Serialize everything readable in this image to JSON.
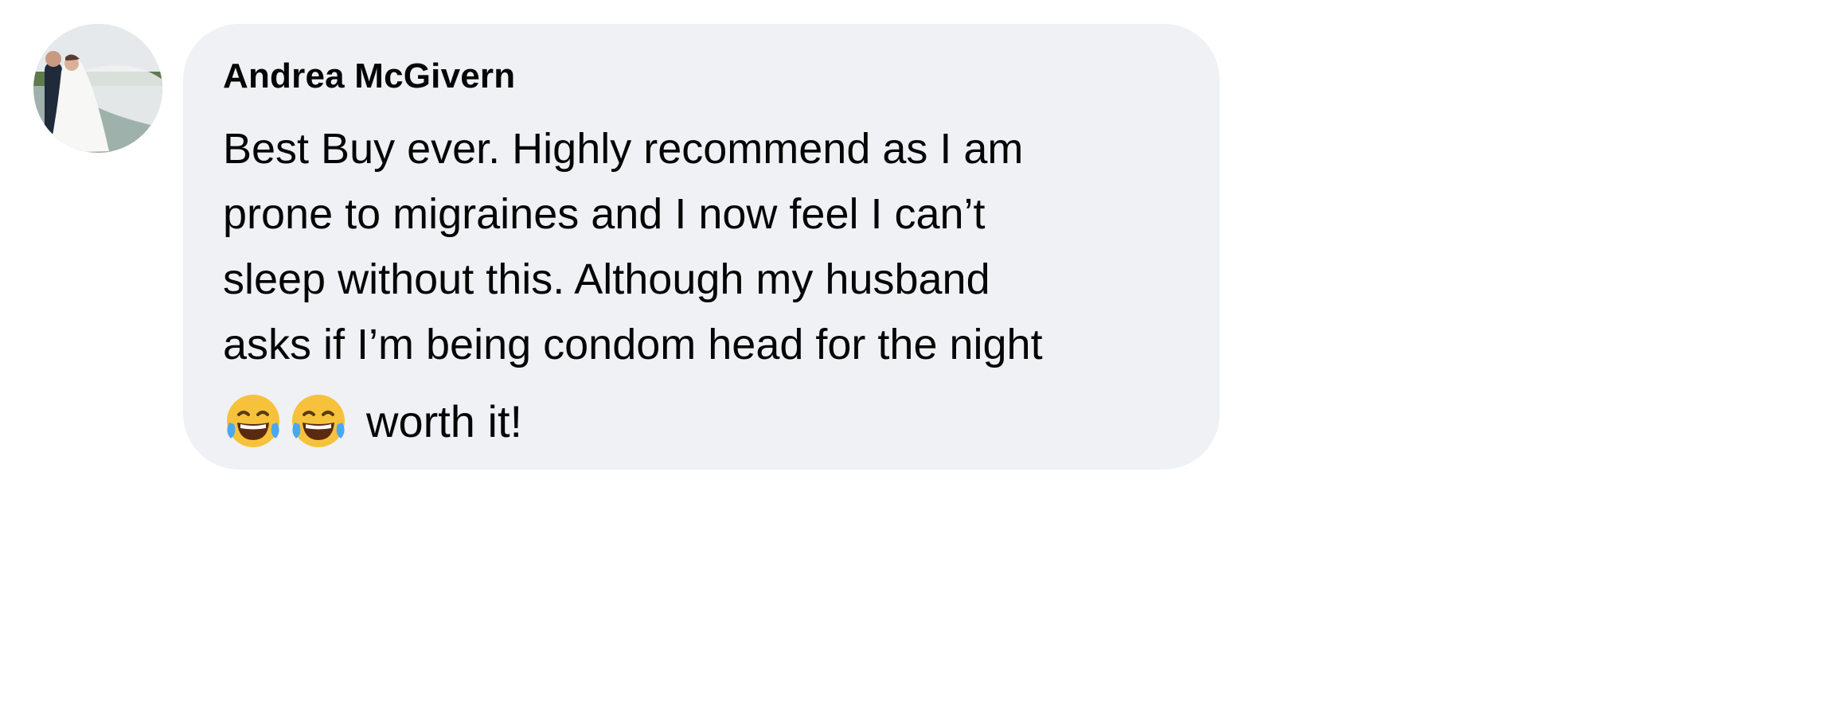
{
  "comment": {
    "author": "Andrea McGivern",
    "lines": [
      "Best Buy ever. Highly recommend as I am",
      "prone to migraines and I now feel I can’t",
      "sleep without this. Although my husband",
      "asks if I’m being condom head for the night"
    ],
    "emojis": [
      "face-with-tears-of-joy-icon",
      "face-with-tears-of-joy-icon"
    ],
    "closing_text": "worth it!"
  },
  "colors": {
    "bubble_background": "#eff1f5",
    "text": "#050505"
  }
}
